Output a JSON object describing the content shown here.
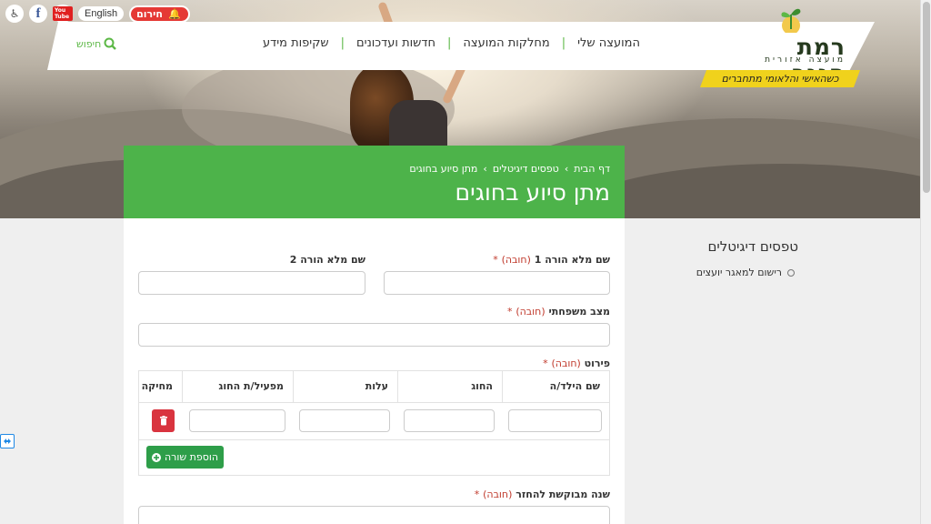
{
  "utility": {
    "english_label": "English",
    "emergency_label": "חירום",
    "youtube_text": "You Tube"
  },
  "logo": {
    "name": "רמת הנגב",
    "subtitle": "מועצה אזורית",
    "slogan": "כשהאישי והלאומי מתחברים"
  },
  "nav": {
    "items": [
      "המועצה שלי",
      "מחלקות המועצה",
      "חדשות ועדכונים",
      "שקיפות מידע"
    ],
    "search_label": "חיפוש"
  },
  "breadcrumb": [
    "דף הבית",
    "טפסים דיגיטלים",
    "מתן סיוע בחוגים"
  ],
  "page_title": "מתן סיוע בחוגים",
  "form": {
    "required_text": "(חובה)",
    "parent1_label": "שם מלא הורה 1",
    "parent2_label": "שם מלא הורה 2",
    "marital_label": "מצב משפחתי",
    "details_label": "פירוט",
    "table_headers": [
      "שם הילד/ה",
      "החוג",
      "עלות",
      "מפעיל/ת החוג",
      "מחיקה"
    ],
    "add_row_label": "הוספת שורה",
    "year_label": "שנה מבוקשת להחזר"
  },
  "sidebar": {
    "title": "טפסים דיגיטלים",
    "items": [
      "רישום למאגר יועצים"
    ]
  },
  "colors": {
    "accent_green": "#4db34a",
    "button_green": "#2e9e49",
    "delete_red": "#d9343f",
    "slogan_yellow": "#f0d21c"
  }
}
